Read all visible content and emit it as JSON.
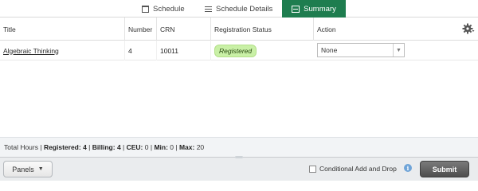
{
  "tabs": [
    {
      "label": "Schedule",
      "icon": "calendar-icon"
    },
    {
      "label": "Schedule Details",
      "icon": "list-icon"
    },
    {
      "label": "Summary",
      "icon": "summary-icon",
      "active": true
    }
  ],
  "table": {
    "headers": {
      "title": "Title",
      "number": "Number",
      "crn": "CRN",
      "status": "Registration Status",
      "action": "Action"
    },
    "rows": [
      {
        "title": "Algebraic Thinking",
        "number": "4",
        "crn": "10011",
        "status": "Registered",
        "action": "None"
      }
    ]
  },
  "totals": {
    "label": "Total Hours |",
    "registered_label": "Registered:",
    "registered": "4",
    "billing_label": "Billing:",
    "billing": "4",
    "ceu_label": "CEU:",
    "ceu": "0",
    "min_label": "Min:",
    "min": "0",
    "max_label": "Max:",
    "max": "20"
  },
  "footer": {
    "panels_label": "Panels",
    "conditional_label": "Conditional Add and Drop",
    "submit_label": "Submit"
  },
  "colors": {
    "accent": "#1e7d4f",
    "status_badge": "#c9f0a6",
    "info": "#6fa4d8"
  }
}
